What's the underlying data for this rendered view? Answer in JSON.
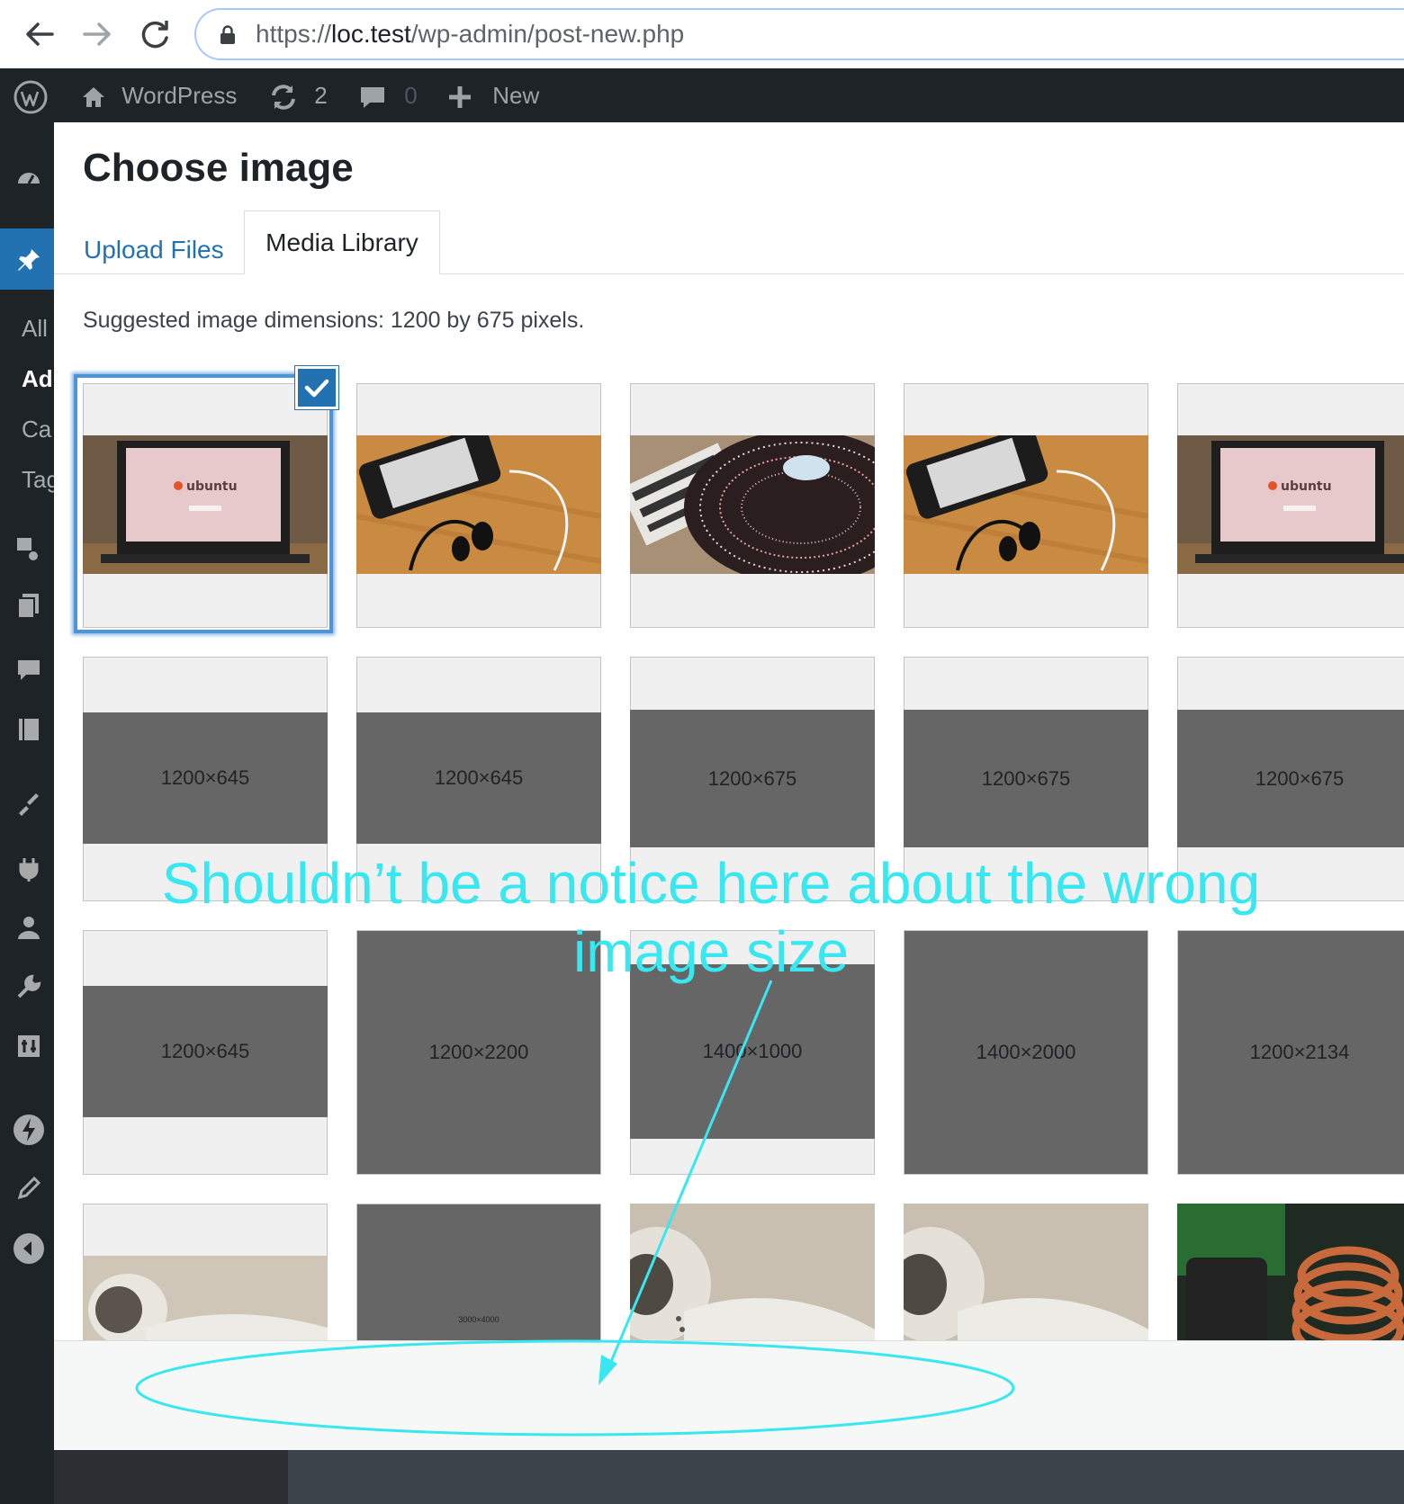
{
  "browser": {
    "url_prefix": "https://",
    "url_host": "loc.test",
    "url_path": "/wp-admin/post-new.php"
  },
  "admin_bar": {
    "site_name": "WordPress",
    "updates_count": "2",
    "comments_count": "0",
    "new_label": "New"
  },
  "sidebar": {
    "items": [
      "All",
      "Ad",
      "Ca",
      "Tag"
    ]
  },
  "modal": {
    "title": "Choose image",
    "tabs": [
      {
        "label": "Upload Files"
      },
      {
        "label": "Media Library"
      }
    ],
    "suggestion": "Suggested image dimensions: 1200 by 675 pixels."
  },
  "media": {
    "row2": [
      "1200×645",
      "1200×645",
      "1200×675",
      "1200×675",
      "1200×675"
    ],
    "row3": [
      "1200×645",
      "1200×2200",
      "1400×1000",
      "1400×2000",
      "1200×2134"
    ],
    "row4_placeholder": "3000×4000"
  },
  "annotation": {
    "text": "Shouldn’t be a notice here about the wrong image size",
    "color": "#39e7f0"
  },
  "colors": {
    "wp_blue": "#2271b1",
    "admin_bar": "#1d2327",
    "placeholder": "#666666"
  }
}
